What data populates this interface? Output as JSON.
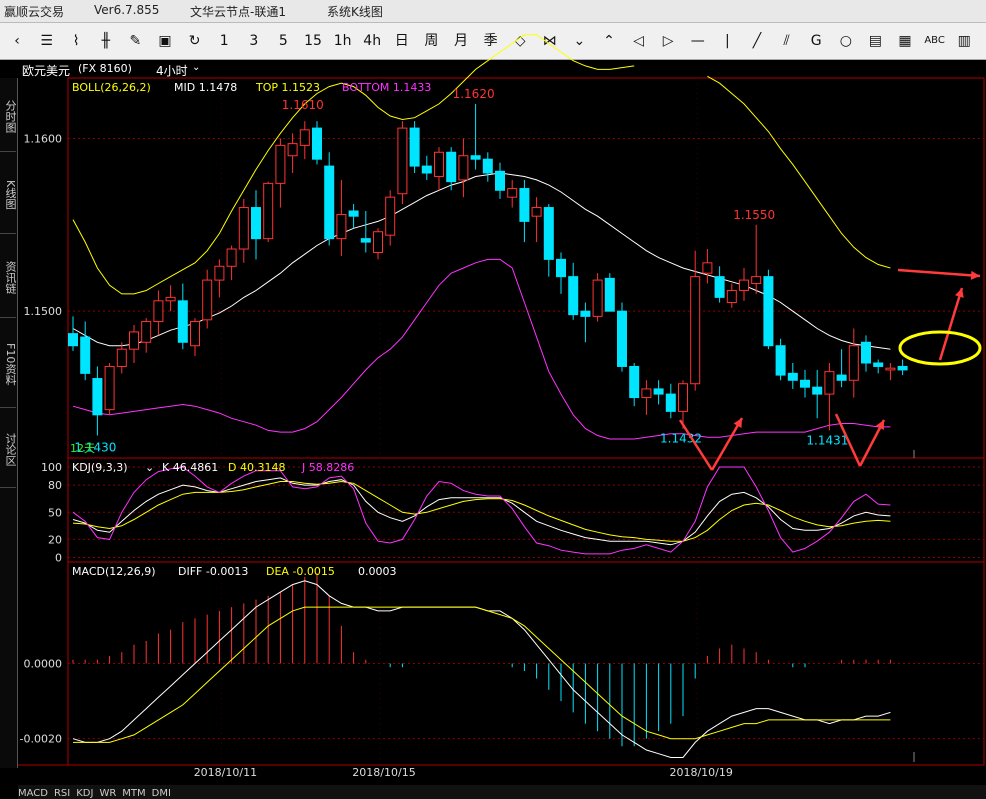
{
  "titlebar": {
    "app": "赢顺云交易",
    "version": "Ver6.7.855",
    "node": "文华云节点-联通1",
    "view": "系统K线图"
  },
  "toolbar": {
    "items": [
      {
        "name": "back-icon",
        "glyph": "‹"
      },
      {
        "name": "list-icon",
        "glyph": "☰"
      },
      {
        "name": "line-chart-icon",
        "glyph": "⌇"
      },
      {
        "name": "kline-icon",
        "glyph": "╫"
      },
      {
        "name": "pen-icon",
        "glyph": "✎"
      },
      {
        "name": "save-icon",
        "glyph": "▣"
      },
      {
        "name": "refresh-icon",
        "glyph": "↻"
      },
      {
        "name": "period-1",
        "glyph": "1"
      },
      {
        "name": "period-3",
        "glyph": "3"
      },
      {
        "name": "period-5",
        "glyph": "5"
      },
      {
        "name": "period-15",
        "glyph": "15"
      },
      {
        "name": "period-1h",
        "glyph": "1h"
      },
      {
        "name": "period-4h",
        "glyph": "4h"
      },
      {
        "name": "period-day",
        "glyph": "日"
      },
      {
        "name": "period-week",
        "glyph": "周"
      },
      {
        "name": "period-month",
        "glyph": "月"
      },
      {
        "name": "period-season",
        "glyph": "季"
      },
      {
        "name": "zoom-in-icon",
        "glyph": "◇"
      },
      {
        "name": "zoom-out-icon",
        "glyph": "⋈"
      },
      {
        "name": "expand-down-icon",
        "glyph": "⌄"
      },
      {
        "name": "expand-up-icon",
        "glyph": "⌃"
      },
      {
        "name": "scroll-left-icon",
        "glyph": "◁"
      },
      {
        "name": "scroll-right-icon",
        "glyph": "▷"
      },
      {
        "name": "hline-icon",
        "glyph": "—"
      },
      {
        "name": "vline-icon",
        "glyph": "|"
      },
      {
        "name": "trendline-icon",
        "glyph": "╱"
      },
      {
        "name": "channel-icon",
        "glyph": "⫽"
      },
      {
        "name": "fib-icon",
        "glyph": "G"
      },
      {
        "name": "circle-icon",
        "glyph": "○"
      },
      {
        "name": "box-icon",
        "glyph": "▤"
      },
      {
        "name": "grid-icon",
        "glyph": "▦"
      },
      {
        "name": "text-icon",
        "glyph": "ABC"
      },
      {
        "name": "bars-icon",
        "glyph": "▥"
      }
    ]
  },
  "infobar": {
    "symbol": "欧元美元",
    "code": "(FX 8160)",
    "period": "4小时"
  },
  "sidetabs": [
    "分时图",
    "K线图",
    "资讯链",
    "F10资料",
    "讨论区"
  ],
  "colors": {
    "up": "#ff3333",
    "down": "#00e5ff",
    "mid": "#ffffff",
    "top": "#ffff00",
    "bottom": "#ff33ff",
    "grid": "#8b0000"
  },
  "chart_data": [
    {
      "type": "candlestick",
      "indicator": "BOLL(26,26,2)",
      "legend": {
        "mid": "MID 1.1478",
        "top": "TOP 1.1523",
        "bottom": "BOTTOM 1.1433"
      },
      "ylim": [
        1.1415,
        1.1635
      ],
      "yticks": [
        "1.1600",
        "1.1500"
      ],
      "annotations": [
        "1.1610",
        "1.1620",
        "1.1550",
        "1.1432",
        "1.1431",
        "1.1430"
      ],
      "period_label": "12天",
      "candles": [
        [
          1.1487,
          1.1497,
          1.1477,
          1.148
        ],
        [
          1.1485,
          1.1494,
          1.146,
          1.1464
        ],
        [
          1.1461,
          1.1468,
          1.1428,
          1.144
        ],
        [
          1.1443,
          1.147,
          1.144,
          1.1468
        ],
        [
          1.1468,
          1.1482,
          1.1464,
          1.1478
        ],
        [
          1.1478,
          1.1492,
          1.147,
          1.1488
        ],
        [
          1.1482,
          1.1496,
          1.1476,
          1.1494
        ],
        [
          1.1494,
          1.1512,
          1.1486,
          1.1506
        ],
        [
          1.1506,
          1.1515,
          1.15,
          1.1508
        ],
        [
          1.1506,
          1.1516,
          1.1478,
          1.1482
        ],
        [
          1.148,
          1.1496,
          1.1474,
          1.1494
        ],
        [
          1.1495,
          1.1524,
          1.149,
          1.1518
        ],
        [
          1.1518,
          1.153,
          1.1508,
          1.1526
        ],
        [
          1.1526,
          1.1538,
          1.1518,
          1.1536
        ],
        [
          1.1536,
          1.1565,
          1.1528,
          1.156
        ],
        [
          1.156,
          1.157,
          1.153,
          1.1542
        ],
        [
          1.1542,
          1.1575,
          1.154,
          1.1574
        ],
        [
          1.1574,
          1.16,
          1.156,
          1.1596
        ],
        [
          1.159,
          1.1603,
          1.158,
          1.1597
        ],
        [
          1.1596,
          1.161,
          1.1588,
          1.1605
        ],
        [
          1.1606,
          1.161,
          1.1585,
          1.1588
        ],
        [
          1.1584,
          1.1592,
          1.1538,
          1.1542
        ],
        [
          1.1542,
          1.1576,
          1.1532,
          1.1556
        ],
        [
          1.1558,
          1.1562,
          1.1548,
          1.1555
        ],
        [
          1.1542,
          1.1558,
          1.1534,
          1.154
        ],
        [
          1.1534,
          1.1548,
          1.153,
          1.1546
        ],
        [
          1.1544,
          1.157,
          1.1538,
          1.1566
        ],
        [
          1.1568,
          1.161,
          1.1562,
          1.1606
        ],
        [
          1.1606,
          1.161,
          1.158,
          1.1584
        ],
        [
          1.1584,
          1.159,
          1.1576,
          1.158
        ],
        [
          1.1578,
          1.1595,
          1.157,
          1.1592
        ],
        [
          1.1592,
          1.1595,
          1.157,
          1.1575
        ],
        [
          1.1576,
          1.16,
          1.1566,
          1.159
        ],
        [
          1.159,
          1.162,
          1.1582,
          1.1588
        ],
        [
          1.1588,
          1.1592,
          1.1575,
          1.158
        ],
        [
          1.1581,
          1.1586,
          1.1565,
          1.157
        ],
        [
          1.1566,
          1.1576,
          1.156,
          1.1571
        ],
        [
          1.1571,
          1.1576,
          1.154,
          1.1552
        ],
        [
          1.1555,
          1.1566,
          1.154,
          1.156
        ],
        [
          1.156,
          1.1562,
          1.152,
          1.153
        ],
        [
          1.153,
          1.1534,
          1.151,
          1.152
        ],
        [
          1.152,
          1.1528,
          1.1495,
          1.1498
        ],
        [
          1.15,
          1.1505,
          1.1482,
          1.1497
        ],
        [
          1.1497,
          1.1522,
          1.1494,
          1.1518
        ],
        [
          1.1519,
          1.1522,
          1.15,
          1.15
        ],
        [
          1.15,
          1.1505,
          1.1465,
          1.1468
        ],
        [
          1.1468,
          1.147,
          1.1445,
          1.145
        ],
        [
          1.145,
          1.146,
          1.144,
          1.1455
        ],
        [
          1.1455,
          1.146,
          1.1446,
          1.1452
        ],
        [
          1.1452,
          1.1458,
          1.1438,
          1.1442
        ],
        [
          1.1442,
          1.146,
          1.1432,
          1.1458
        ],
        [
          1.1458,
          1.1535,
          1.1454,
          1.152
        ],
        [
          1.1522,
          1.1536,
          1.1516,
          1.1528
        ],
        [
          1.152,
          1.1526,
          1.1505,
          1.1508
        ],
        [
          1.1505,
          1.1516,
          1.1502,
          1.1512
        ],
        [
          1.1512,
          1.1525,
          1.1506,
          1.1518
        ],
        [
          1.1516,
          1.155,
          1.151,
          1.152
        ],
        [
          1.152,
          1.1524,
          1.1478,
          1.148
        ],
        [
          1.148,
          1.1484,
          1.146,
          1.1463
        ],
        [
          1.1464,
          1.147,
          1.1455,
          1.146
        ],
        [
          1.146,
          1.1466,
          1.145,
          1.1456
        ],
        [
          1.1456,
          1.1466,
          1.1438,
          1.1452
        ],
        [
          1.1452,
          1.147,
          1.1431,
          1.1465
        ],
        [
          1.1463,
          1.1478,
          1.1456,
          1.146
        ],
        [
          1.146,
          1.149,
          1.145,
          1.148
        ],
        [
          1.1482,
          1.1486,
          1.1465,
          1.147
        ],
        [
          1.147,
          1.1472,
          1.1464,
          1.1468
        ],
        [
          1.1466,
          1.147,
          1.146,
          1.1467
        ],
        [
          1.1468,
          1.1472,
          1.1463,
          1.1466
        ]
      ],
      "mid": [
        1.149,
        1.1486,
        1.1482,
        1.148,
        1.148,
        1.1481,
        1.1483,
        1.1486,
        1.1489,
        1.1491,
        1.1493,
        1.1496,
        1.1499,
        1.1503,
        1.1508,
        1.1512,
        1.1517,
        1.1522,
        1.1528,
        1.1533,
        1.1538,
        1.1542,
        1.1545,
        1.1548,
        1.155,
        1.1552,
        1.1555,
        1.1559,
        1.1563,
        1.1567,
        1.157,
        1.1573,
        1.1575,
        1.1578,
        1.1579,
        1.158,
        1.1579,
        1.1578,
        1.1576,
        1.1573,
        1.1569,
        1.1564,
        1.1559,
        1.1555,
        1.155,
        1.1545,
        1.154,
        1.1535,
        1.1531,
        1.1528,
        1.1525,
        1.1523,
        1.1521,
        1.1519,
        1.1517,
        1.1515,
        1.1512,
        1.1509,
        1.1505,
        1.15,
        1.1495,
        1.149,
        1.1486,
        1.1483,
        1.1481,
        1.148,
        1.1479,
        1.1478
      ],
      "top": [
        1.1553,
        1.154,
        1.1525,
        1.1515,
        1.151,
        1.151,
        1.1512,
        1.1516,
        1.152,
        1.1524,
        1.1528,
        1.1535,
        1.1545,
        1.1558,
        1.157,
        1.1582,
        1.1593,
        1.1603,
        1.1612,
        1.162,
        1.1626,
        1.163,
        1.1632,
        1.163,
        1.1625,
        1.1618,
        1.1613,
        1.1611,
        1.1612,
        1.1616,
        1.162,
        1.1626,
        1.1633,
        1.164,
        1.1645,
        1.165,
        1.1655,
        1.166,
        1.166,
        1.1655,
        1.165,
        1.1645,
        1.1642,
        1.164,
        1.164,
        1.1641,
        1.1642,
        null,
        null,
        null,
        null,
        null,
        null,
        null,
        null,
        null,
        null,
        null,
        null,
        null,
        null,
        null,
        null,
        null,
        null,
        null,
        null,
        null
      ],
      "top_tail": [
        1.1636,
        1.1632,
        1.1626,
        1.162,
        1.1612,
        1.1604,
        1.1594,
        1.1585,
        1.1575,
        1.1565,
        1.1555,
        1.1545,
        1.1537,
        1.1531,
        1.1527,
        1.1525
      ],
      "bottom": [
        1.1445,
        1.1443,
        1.1441,
        1.144,
        1.1441,
        1.1442,
        1.1443,
        1.1444,
        1.1445,
        1.1446,
        1.1445,
        1.1443,
        1.1441,
        1.1438,
        1.1436,
        1.1434,
        1.1431,
        1.143,
        1.143,
        1.1432,
        1.1436,
        1.1443,
        1.145,
        1.1458,
        1.1466,
        1.1473,
        1.1478,
        1.1485,
        1.1495,
        1.1505,
        1.1515,
        1.1522,
        1.1525,
        1.1528,
        1.153,
        1.153,
        1.1525,
        1.1505,
        1.1485,
        1.1465,
        1.1452,
        1.144,
        1.1432,
        1.1428,
        1.1426,
        1.1426,
        1.1426,
        1.1427,
        1.1428,
        1.1429,
        1.1429,
        1.1428,
        1.1427,
        1.1427,
        1.1428,
        1.1429,
        1.143,
        1.143,
        1.143,
        1.143,
        1.143,
        1.1432,
        1.1434,
        1.1435,
        1.1435,
        1.1434,
        1.1433,
        1.1433
      ]
    },
    {
      "type": "line",
      "indicator": "KDJ(9,3,3)",
      "legend": {
        "k": "K 46.4861",
        "d": "D 40.3148",
        "j": "J 58.8286"
      },
      "ylim": [
        -5,
        110
      ],
      "yticks": [
        "100",
        "80",
        "50",
        "20",
        "0"
      ],
      "k": [
        42,
        38,
        30,
        28,
        40,
        52,
        62,
        70,
        75,
        80,
        78,
        74,
        72,
        76,
        80,
        84,
        86,
        88,
        82,
        80,
        80,
        84,
        86,
        80,
        62,
        50,
        44,
        40,
        46,
        56,
        64,
        66,
        66,
        66,
        66,
        66,
        60,
        50,
        40,
        35,
        30,
        26,
        22,
        20,
        18,
        18,
        18,
        18,
        16,
        14,
        18,
        28,
        46,
        62,
        70,
        72,
        66,
        56,
        42,
        32,
        30,
        30,
        32,
        38,
        46,
        50,
        47,
        46
      ],
      "d": [
        38,
        37,
        34,
        32,
        35,
        42,
        50,
        58,
        64,
        70,
        72,
        72,
        72,
        73,
        75,
        78,
        81,
        84,
        84,
        82,
        81,
        82,
        84,
        82,
        74,
        66,
        58,
        50,
        48,
        50,
        54,
        58,
        62,
        64,
        65,
        65,
        63,
        58,
        52,
        46,
        41,
        36,
        31,
        28,
        25,
        23,
        22,
        20,
        19,
        18,
        18,
        22,
        30,
        42,
        52,
        58,
        60,
        58,
        52,
        45,
        40,
        36,
        34,
        35,
        38,
        40,
        41,
        40
      ],
      "j": [
        50,
        40,
        22,
        20,
        50,
        72,
        86,
        95,
        98,
        100,
        90,
        78,
        72,
        82,
        90,
        96,
        96,
        96,
        78,
        76,
        78,
        88,
        90,
        76,
        38,
        18,
        16,
        20,
        42,
        68,
        84,
        82,
        74,
        70,
        68,
        68,
        54,
        34,
        16,
        13,
        8,
        6,
        4,
        4,
        4,
        8,
        10,
        14,
        10,
        6,
        18,
        40,
        78,
        100,
        100,
        100,
        78,
        52,
        22,
        6,
        10,
        18,
        28,
        44,
        62,
        70,
        59,
        58
      ]
    },
    {
      "type": "bar+line",
      "indicator": "MACD(12,26,9)",
      "legend": {
        "diff": "DIFF -0.0013",
        "dea": "DEA -0.0015",
        "macd": "0.0003"
      },
      "ylim": [
        -0.0027,
        0.0027
      ],
      "yticks": [
        "0.0000",
        "-0.0020"
      ],
      "diff": [
        -0.002,
        -0.0021,
        -0.0021,
        -0.002,
        -0.0018,
        -0.0015,
        -0.0012,
        -0.0009,
        -0.0006,
        -0.0003,
        0.0,
        0.0003,
        0.0006,
        0.0009,
        0.0012,
        0.0015,
        0.0017,
        0.0019,
        0.0021,
        0.0022,
        0.0021,
        0.0018,
        0.0016,
        0.0015,
        0.0015,
        0.0014,
        0.0014,
        0.0015,
        0.0015,
        0.0015,
        0.0015,
        0.0015,
        0.0015,
        0.0015,
        0.0014,
        0.0014,
        0.0012,
        0.0009,
        0.0005,
        0.0001,
        -0.0003,
        -0.0007,
        -0.001,
        -0.0013,
        -0.0016,
        -0.0019,
        -0.0021,
        -0.0023,
        -0.0024,
        -0.0025,
        -0.0025,
        -0.0021,
        -0.0018,
        -0.0016,
        -0.0014,
        -0.0013,
        -0.0012,
        -0.0012,
        -0.0013,
        -0.0014,
        -0.0015,
        -0.0015,
        -0.0016,
        -0.0015,
        -0.0015,
        -0.0014,
        -0.0014,
        -0.0013
      ],
      "dea": [
        -0.0021,
        -0.0021,
        -0.0021,
        -0.0021,
        -0.002,
        -0.0019,
        -0.0017,
        -0.0015,
        -0.0013,
        -0.0011,
        -0.0008,
        -0.0005,
        -0.0002,
        0.0001,
        0.0004,
        0.0007,
        0.001,
        0.0012,
        0.0014,
        0.0015,
        0.0015,
        0.0015,
        0.0015,
        0.0015,
        0.0015,
        0.0015,
        0.0015,
        0.0015,
        0.0015,
        0.0015,
        0.0015,
        0.0015,
        0.0015,
        0.0015,
        0.0014,
        0.0013,
        0.0012,
        0.001,
        0.0007,
        0.0004,
        0.0001,
        -0.0002,
        -0.0005,
        -0.0008,
        -0.0011,
        -0.0014,
        -0.0016,
        -0.0018,
        -0.0019,
        -0.002,
        -0.002,
        -0.002,
        -0.0019,
        -0.0018,
        -0.0017,
        -0.0016,
        -0.0016,
        -0.0015,
        -0.0015,
        -0.0015,
        -0.0015,
        -0.0015,
        -0.0015,
        -0.0015,
        -0.0015,
        -0.0015,
        -0.0015,
        -0.0015
      ],
      "macd": [
        0.0001,
        0.0001,
        0.0001,
        0.0002,
        0.0003,
        0.0005,
        0.0006,
        0.0008,
        0.0009,
        0.0011,
        0.0012,
        0.0013,
        0.0014,
        0.0015,
        0.0016,
        0.0017,
        0.0018,
        0.0019,
        0.0021,
        0.0023,
        0.0024,
        0.0018,
        0.001,
        0.0003,
        0.0001,
        0.0,
        -0.0001,
        -0.0001,
        0.0,
        0.0,
        0.0,
        0.0,
        0.0,
        0.0,
        0.0,
        0.0,
        -0.0001,
        -0.0002,
        -0.0004,
        -0.0007,
        -0.001,
        -0.0013,
        -0.0016,
        -0.0018,
        -0.002,
        -0.0022,
        -0.0022,
        -0.002,
        -0.0018,
        -0.0016,
        -0.0014,
        -0.0004,
        0.0002,
        0.0004,
        0.0005,
        0.0004,
        0.0003,
        0.0001,
        0.0,
        -0.0001,
        -0.0001,
        0.0,
        0.0,
        0.0001,
        0.0001,
        0.0001,
        0.0001,
        0.0001
      ]
    }
  ],
  "xaxis": {
    "labels": [
      "2018/10/11",
      "2018/10/15",
      "2018/10/19"
    ]
  },
  "bottomtabs": [
    "MACD",
    "RSI",
    "KDJ",
    "WR",
    "MTM",
    "DMI"
  ]
}
